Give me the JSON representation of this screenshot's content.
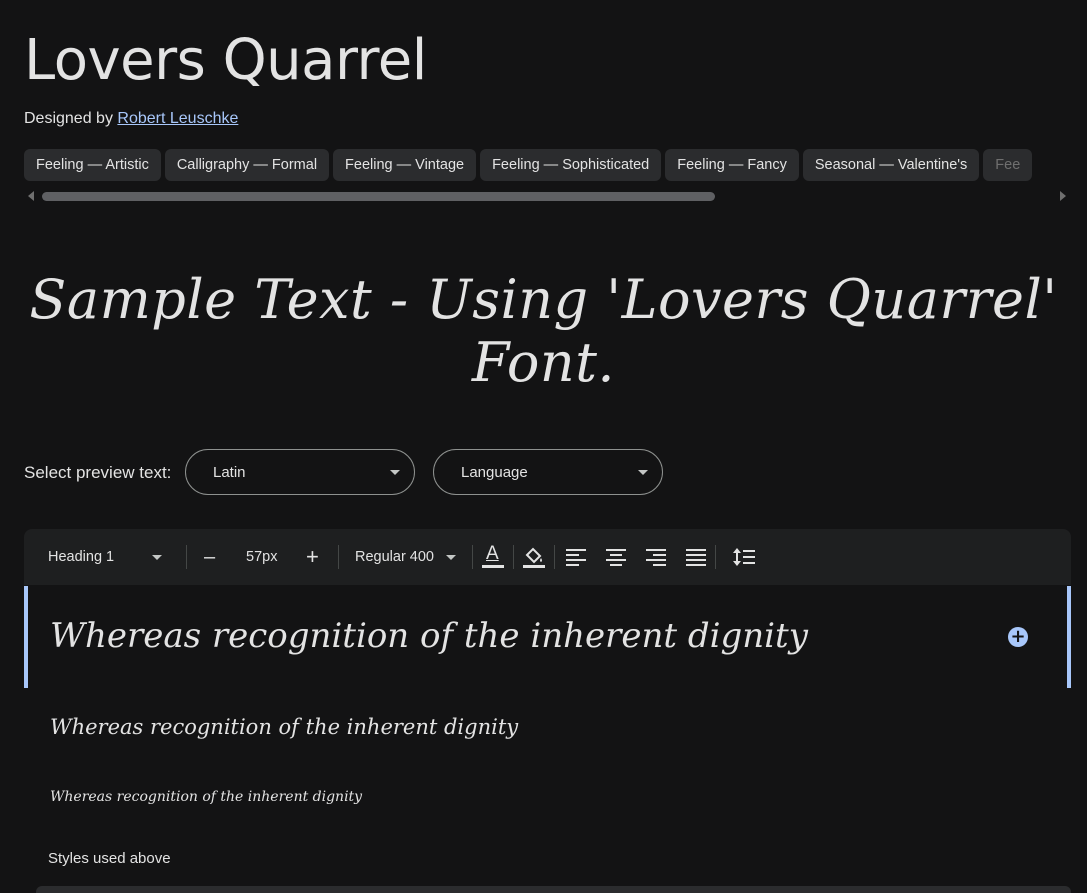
{
  "header": {
    "title": "Lovers Quarrel",
    "designed_by_prefix": "Designed by",
    "designer_name": "Robert Leuschke"
  },
  "tags": [
    "Feeling — Artistic",
    "Calligraphy — Formal",
    "Feeling — Vintage",
    "Feeling — Sophisticated",
    "Feeling — Fancy",
    "Seasonal — Valentine's",
    "Fee"
  ],
  "hero_sample": "Sample Text - Using 'Lovers Quarrel' Font.",
  "preview": {
    "label": "Select preview text:",
    "script_value": "Latin",
    "language_value": "Language"
  },
  "toolbar": {
    "style_select": "Heading 1",
    "decrease": "–",
    "size": "57px",
    "increase": "+",
    "weight_select": "Regular 400",
    "text_color_glyph": "A"
  },
  "samples": [
    "Whereas recognition of the inherent dignity",
    "Whereas recognition of the inherent dignity",
    "Whereas recognition of the inherent dignity"
  ],
  "add_glyph": "+",
  "styles_label": "Styles used above",
  "colors": {
    "background": "#131314",
    "chip": "#2b2c2e",
    "accent": "#a8c7fa",
    "toolbar": "#1e1f20"
  }
}
